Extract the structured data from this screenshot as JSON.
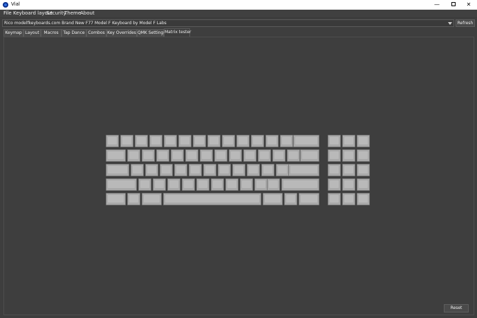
{
  "window": {
    "title": "Vial",
    "minimize_glyph": "—",
    "close_glyph": "✕",
    "icon": "vial-app-icon"
  },
  "menu": {
    "items": [
      "File",
      "Keyboard layout",
      "Security",
      "Theme",
      "About"
    ]
  },
  "device": {
    "selected": "Rico modelfkeyboards.com Brand New F77 Model F Keyboard by Model F Labs",
    "refresh_label": "Refresh"
  },
  "tabs": [
    {
      "label": "Keymap",
      "active": false
    },
    {
      "label": "Layout",
      "active": false
    },
    {
      "label": "Macros",
      "active": false
    },
    {
      "label": "Tap Dance",
      "active": false
    },
    {
      "label": "Combos",
      "active": false
    },
    {
      "label": "Key Overrides",
      "active": false
    },
    {
      "label": "QMK Settings",
      "active": false
    },
    {
      "label": "Matrix tester",
      "active": true
    }
  ],
  "matrix": {
    "reset_label": "Reset"
  },
  "colors": {
    "background": "#3e3e3e",
    "key_face": "#b9b9b9",
    "key_border": "#777777"
  }
}
